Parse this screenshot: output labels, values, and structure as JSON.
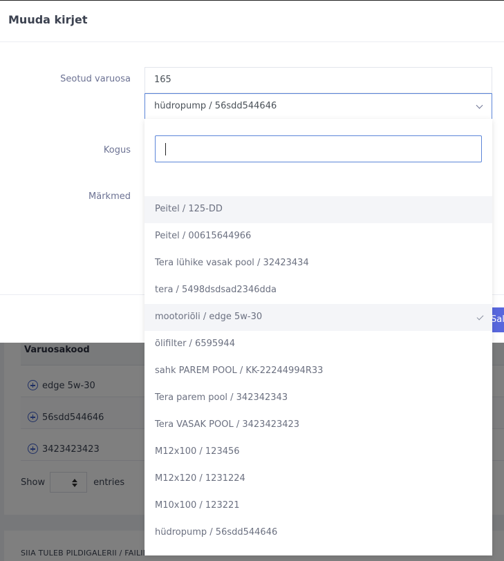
{
  "modal": {
    "title": "Muuda kirjet",
    "labels": {
      "linked_part": "Seotud varuosa",
      "quantity": "Kogus",
      "notes": "Märkmed"
    },
    "linked_part_value": "165",
    "select_value": "hüdropump / 56sdd544646",
    "save_label": "Salv"
  },
  "dropdown": {
    "search_value": "",
    "options": [
      {
        "label": "Peitel / 125-DD"
      },
      {
        "label": "Peitel / 00615644966"
      },
      {
        "label": "Tera lühike vasak pool / 32423434"
      },
      {
        "label": "tera / 5498dsdsad2346dda"
      },
      {
        "label": "mootoriõli / edge 5w-30",
        "selected": true
      },
      {
        "label": "õlifilter / 6595944"
      },
      {
        "label": "sahk PAREM POOL / KK-22244994R33"
      },
      {
        "label": "Tera parem pool / 342342343"
      },
      {
        "label": "Tera VASAK POOL / 3423423423"
      },
      {
        "label": "M12x100 / 123456"
      },
      {
        "label": "M12x120 / 1231224"
      },
      {
        "label": "M10x100 / 123221"
      },
      {
        "label": "hüdropump / 56sdd544646"
      }
    ]
  },
  "background": {
    "table": {
      "header": "Varuosakood",
      "rows": [
        "edge 5w-30",
        "56sdd544646",
        "3423423423"
      ]
    },
    "show_label": "Show",
    "entries_label": "entries",
    "gallery_text": "SIIA TULEB PILDIGALERII / FAILID"
  },
  "colors": {
    "accent": "#5867dd",
    "focus_border": "#5b85d8",
    "overlay": "rgba(0,0,0,0.5)"
  }
}
